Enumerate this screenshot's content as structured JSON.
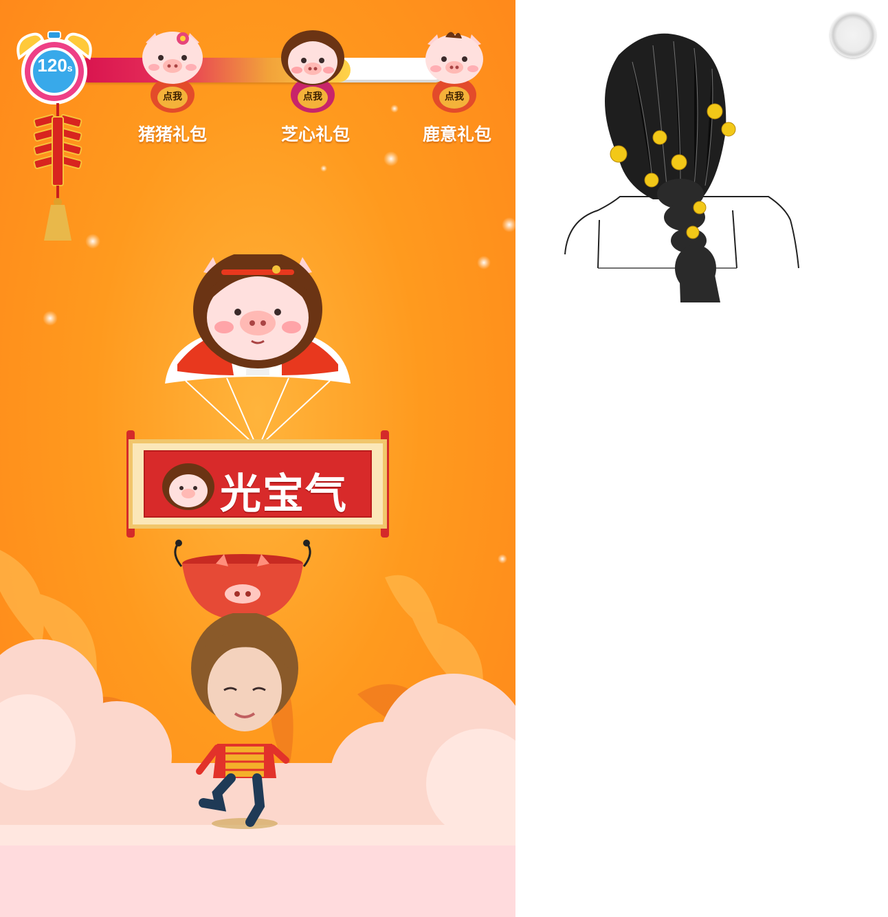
{
  "timer": {
    "value": "120",
    "unit": "s"
  },
  "progress": {
    "fraction": 0.74
  },
  "gift_packs": [
    {
      "name": "猪猪礼包",
      "tap_label": "点我"
    },
    {
      "name": "芝心礼包",
      "tap_label": "点我"
    },
    {
      "name": "鹿意礼包",
      "tap_label": "点我"
    }
  ],
  "banner": {
    "text": "光宝气"
  },
  "colors": {
    "background": "#ff9a1e",
    "banner_red": "#d82a2a",
    "progress_start": "#d8124e",
    "progress_end": "#ffd34a"
  },
  "icons": {
    "timer": "alarm-clock-icon",
    "close": "close-circle-icon",
    "decoration": "firecracker-icon"
  }
}
